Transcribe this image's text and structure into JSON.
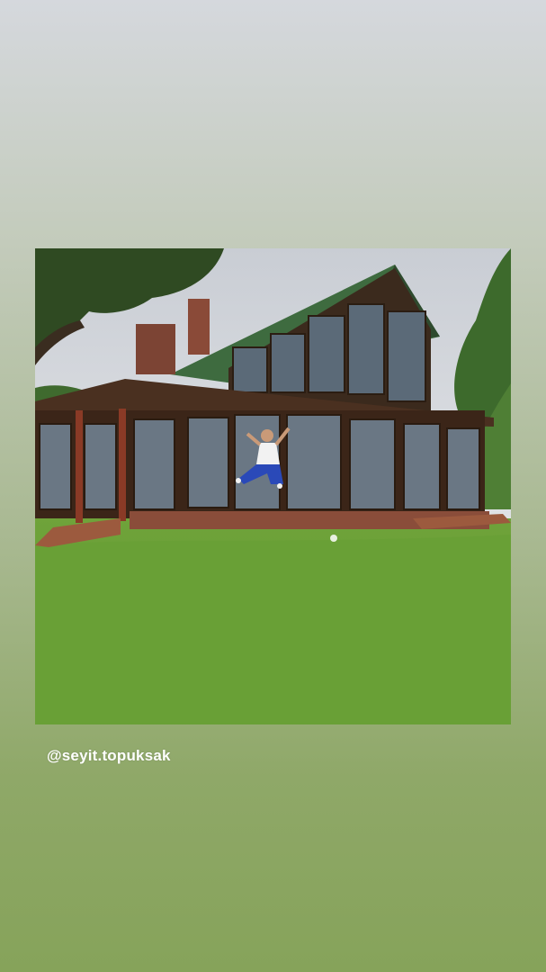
{
  "story": {
    "photo_description_icon": "photo",
    "mention": "@seyit.topuksak"
  },
  "colors": {
    "background_top": "#d5d8dd",
    "background_bottom": "#86a35a",
    "mention_text": "#ffffff"
  }
}
